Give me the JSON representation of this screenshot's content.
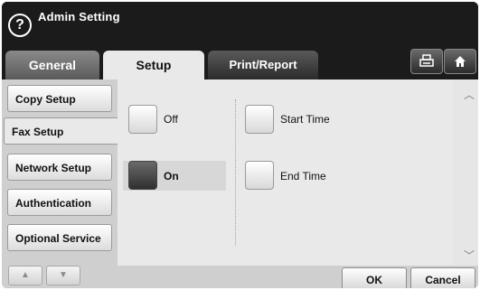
{
  "titlebar": {
    "title": "Admin Setting",
    "help_icon": "?"
  },
  "tabs": [
    {
      "label": "General"
    },
    {
      "label": "Setup",
      "active": true
    },
    {
      "label": "Print/Report"
    }
  ],
  "toolbar": {
    "print_icon": "printer-icon",
    "home_icon": "home-icon"
  },
  "sidebar": {
    "items": [
      {
        "label": "Copy Setup"
      },
      {
        "label": "Fax Setup",
        "active": true
      },
      {
        "label": "Network Setup"
      },
      {
        "label": "Authentication"
      },
      {
        "label": "Optional Service"
      }
    ],
    "up_arrow": "▲",
    "down_arrow": "▼"
  },
  "main": {
    "options": [
      {
        "label": "Off",
        "selected": false
      },
      {
        "label": "On",
        "selected": true
      }
    ],
    "time_fields": [
      {
        "label": "Start Time"
      },
      {
        "label": "End Time"
      }
    ]
  },
  "scroll": {
    "up": "︿",
    "down": "﹀"
  },
  "bottom": {
    "ok_label": "OK",
    "cancel_label": "Cancel"
  },
  "colors": {
    "titlebar_bg": "#1b1b1b",
    "panel_bg": "#e9e9e9",
    "selected": "#3a3a3a"
  }
}
